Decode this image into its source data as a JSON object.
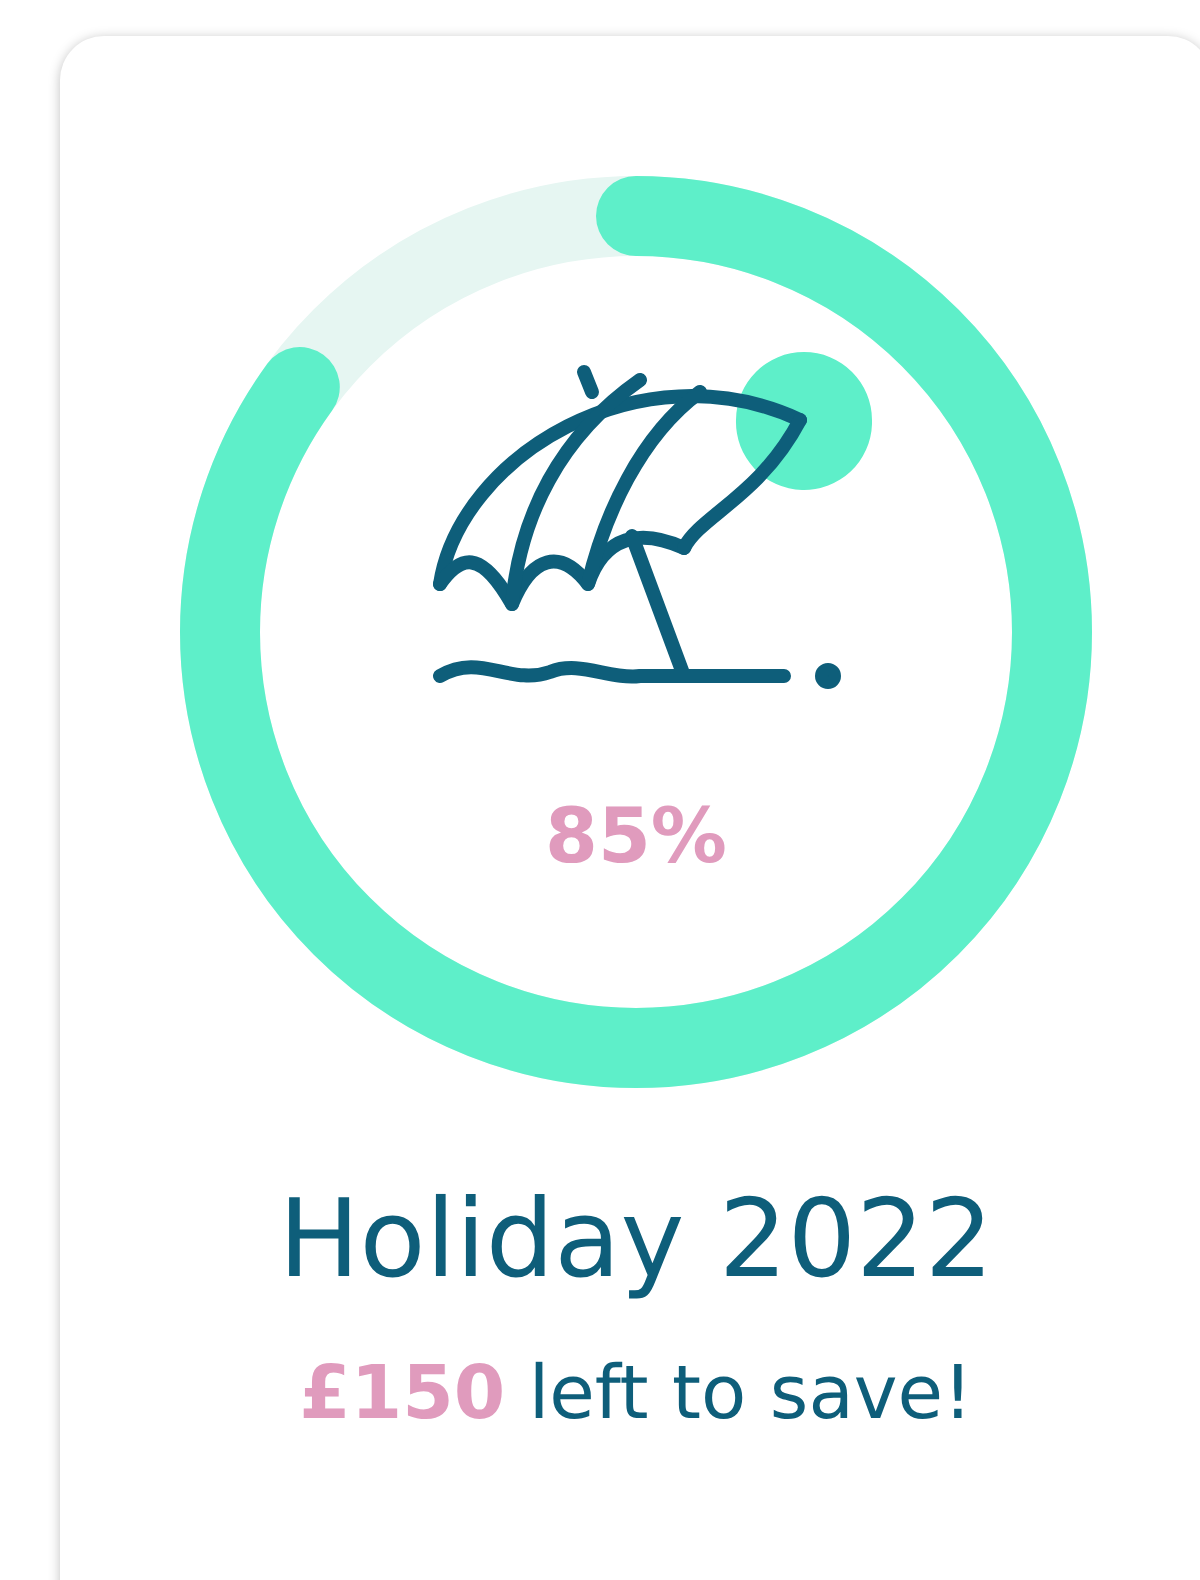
{
  "goal": {
    "progress": {
      "level": 0.85,
      "label": "85%"
    },
    "title": "Holiday 2022",
    "remaining": "**£150** left to save!"
  }
}
